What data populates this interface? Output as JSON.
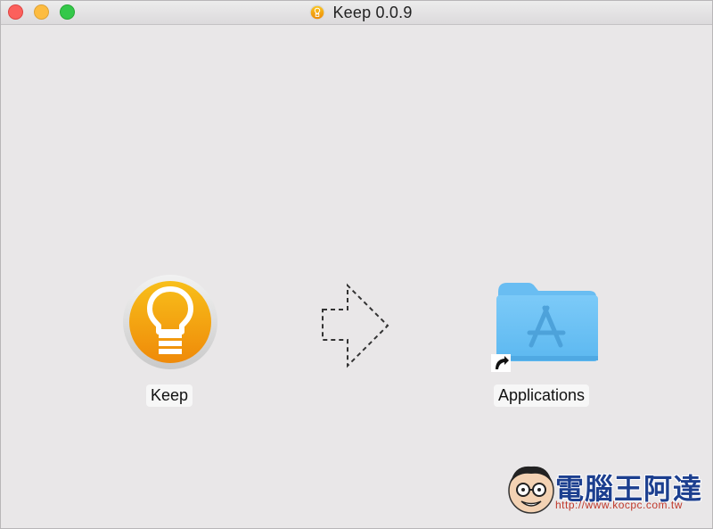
{
  "window": {
    "title": "Keep 0.0.9"
  },
  "app": {
    "name": "Keep",
    "icon": "lightbulb-app-icon",
    "accent_color": "#f3a00b"
  },
  "arrow": {
    "icon": "dashed-right-arrow-icon"
  },
  "target": {
    "name": "Applications",
    "icon": "applications-folder-icon",
    "folder_color": "#6cc2f5"
  },
  "watermark": {
    "title": "電腦王阿達",
    "url": "http://www.kocpc.com.tw",
    "title_color": "#1c3f8f",
    "url_color": "#c0392b"
  }
}
